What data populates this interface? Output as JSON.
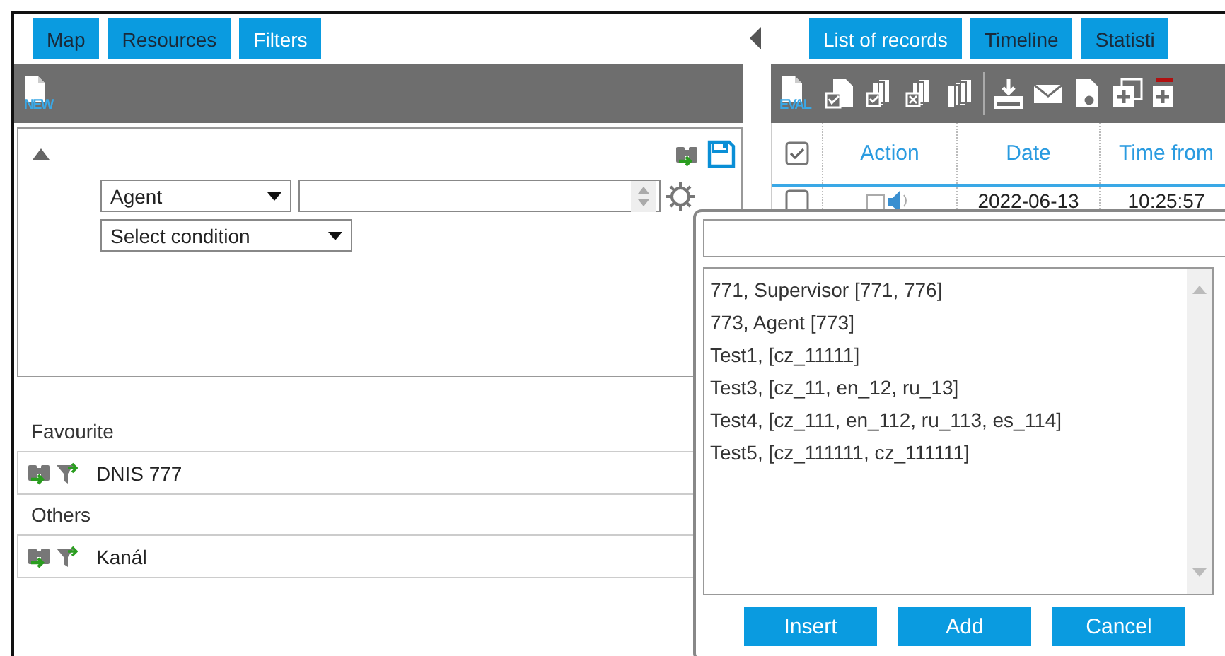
{
  "left_tabs": [
    {
      "label": "Map",
      "selected": false
    },
    {
      "label": "Resources",
      "selected": false
    },
    {
      "label": "Filters",
      "selected": true
    }
  ],
  "left_toolbar": {
    "new_label": "NEW"
  },
  "filter_editor": {
    "expanded": true,
    "field_select": "Agent",
    "condition_select": "Select condition"
  },
  "filter_groups": [
    {
      "title": "Favourite",
      "filters": [
        {
          "name": "DNIS 777"
        }
      ]
    },
    {
      "title": "Others",
      "filters": [
        {
          "name": "Kanál"
        }
      ]
    }
  ],
  "right_tabs": [
    {
      "label": "List of records",
      "selected": true
    },
    {
      "label": "Timeline",
      "selected": false
    },
    {
      "label": "Statisti",
      "selected": false
    }
  ],
  "right_toolbar": {
    "eval_label": "EVAL"
  },
  "table": {
    "all_checked": true,
    "columns": [
      "Action",
      "Date",
      "Time from"
    ],
    "rows": [
      {
        "checked": false,
        "date": "2022-06-13",
        "time_from": "10:25:57"
      }
    ]
  },
  "picker_popup": {
    "items": [
      "771, Supervisor [771, 776]",
      "773, Agent [773]",
      "Test1, [cz_11111]",
      "Test3, [cz_11, en_12, ru_13]",
      "Test4, [cz_111, en_112, ru_113, es_114]",
      "Test5, [cz_111111, cz_111111]"
    ],
    "buttons": [
      "Insert",
      "Add",
      "Cancel"
    ]
  }
}
